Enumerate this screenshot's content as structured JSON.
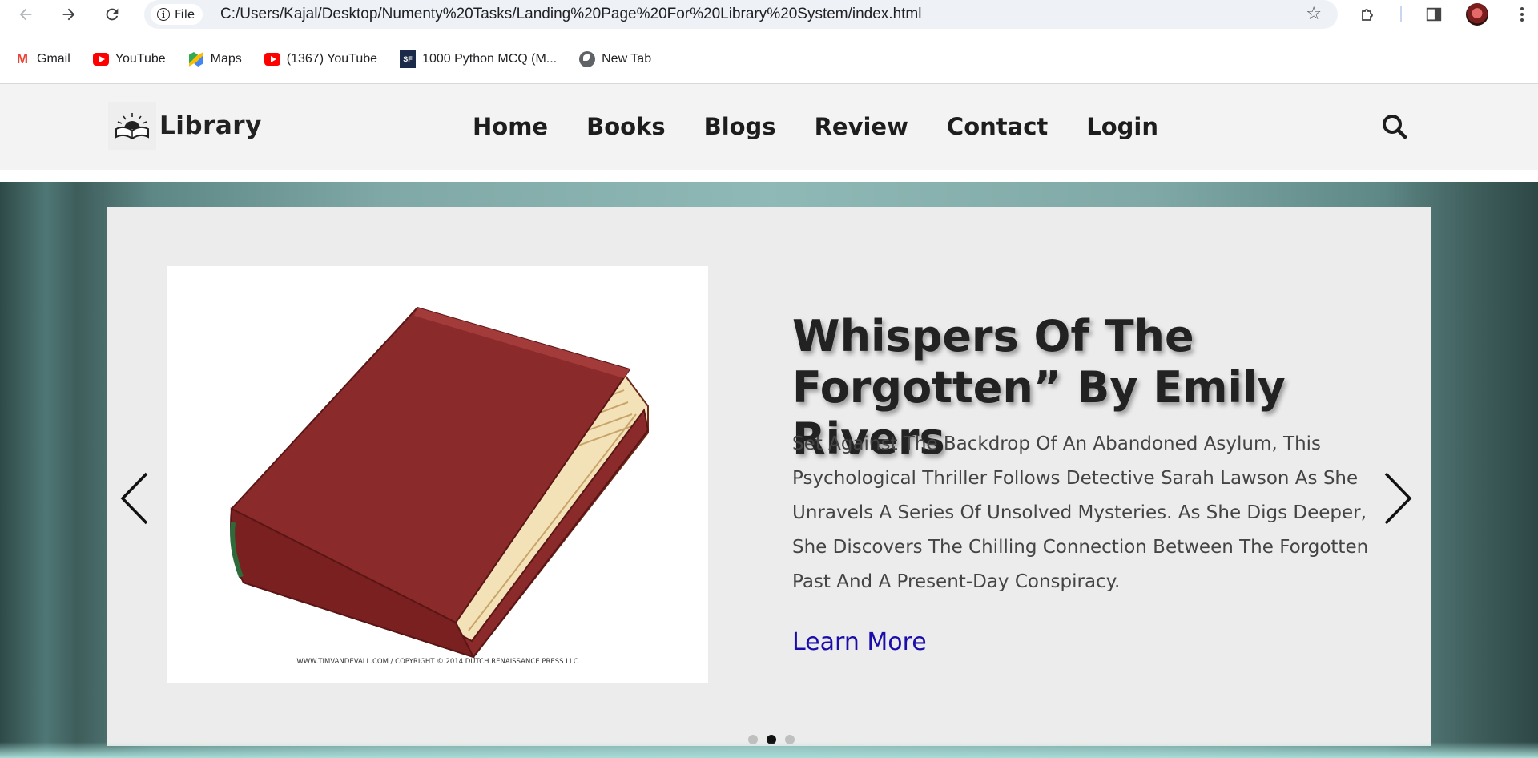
{
  "browser": {
    "url": "C:/Users/Kajal/Desktop/Numenty%20Tasks/Landing%20Page%20For%20Library%20System/index.html",
    "file_chip": "File",
    "bookmarks": [
      {
        "label": "Gmail",
        "icon": "gmail-icon"
      },
      {
        "label": "YouTube",
        "icon": "youtube-icon"
      },
      {
        "label": "Maps",
        "icon": "maps-icon"
      },
      {
        "label": "(1367) YouTube",
        "icon": "youtube-icon"
      },
      {
        "label": "1000 Python MCQ (M...",
        "icon": "sanfoundry-icon"
      },
      {
        "label": "New Tab",
        "icon": "globe-icon"
      }
    ]
  },
  "site": {
    "logo_text": "Library",
    "nav": [
      "Home",
      "Books",
      "Blogs",
      "Review",
      "Contact",
      "Login"
    ]
  },
  "slide": {
    "title": "Whispers Of The Forgotten” By Emily Rivers",
    "description": "Set Against The Backdrop Of An Abandoned Asylum, This Psychological Thriller Follows Detective Sarah Lawson As She Unravels A Series Of Unsolved Mysteries. As She Digs Deeper, She Discovers The Chilling Connection Between The Forgotten Past And A Present-Day Conspiracy.",
    "cta": "Learn More",
    "image_caption": "WWW.TIMVANDEVALL.COM / COPYRIGHT © 2014 DUTCH RENAISSANCE PRESS LLC",
    "pagination": {
      "total": 3,
      "active_index": 1
    }
  },
  "colors": {
    "link": "#1a0dab",
    "book_cover": "#8b2a2a",
    "header_bg": "#f3f3f3"
  }
}
